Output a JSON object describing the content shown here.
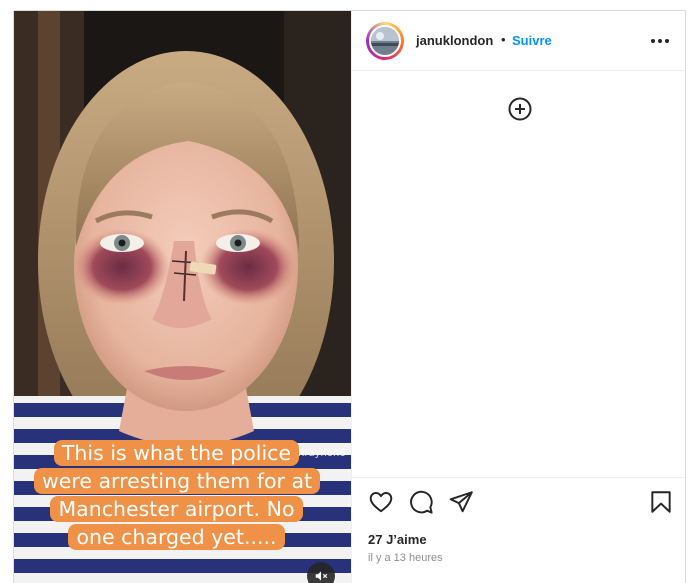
{
  "post": {
    "username": "januklondon",
    "separator": "•",
    "follow_label": "Suivre",
    "media": {
      "caption": "This is what the police were arresting them for at Manchester airport. No one charged yet.....",
      "watermark": "@~~.ahraynon6"
    },
    "likes_label": "27 J’aime",
    "timestamp": "il y a 13 heures",
    "icons": {
      "more": "more-options-icon",
      "add": "add-circle-icon",
      "like": "heart-icon",
      "comment": "comment-icon",
      "share": "paper-plane-icon",
      "save": "bookmark-icon",
      "mute": "speaker-muted-icon"
    },
    "colors": {
      "follow": "#0095f6",
      "caption_bg": "#ef9146",
      "border": "#dbdbdb"
    }
  }
}
